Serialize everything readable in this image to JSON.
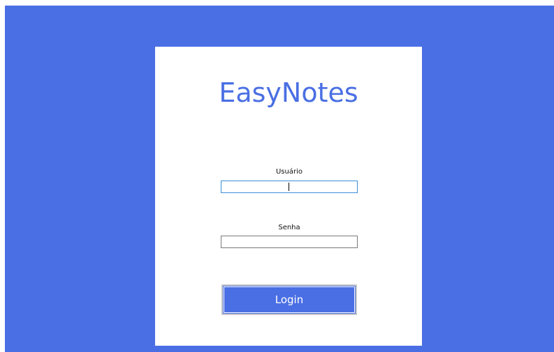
{
  "app": {
    "title": "EasyNotes"
  },
  "login_form": {
    "username": {
      "label": "Usuário",
      "value": ""
    },
    "password": {
      "label": "Senha",
      "value": ""
    },
    "submit_label": "Login"
  },
  "colors": {
    "background": "#4a6fe4",
    "card": "#ffffff",
    "accent": "#4a6fe4",
    "focus_border": "#3c8ed8"
  }
}
